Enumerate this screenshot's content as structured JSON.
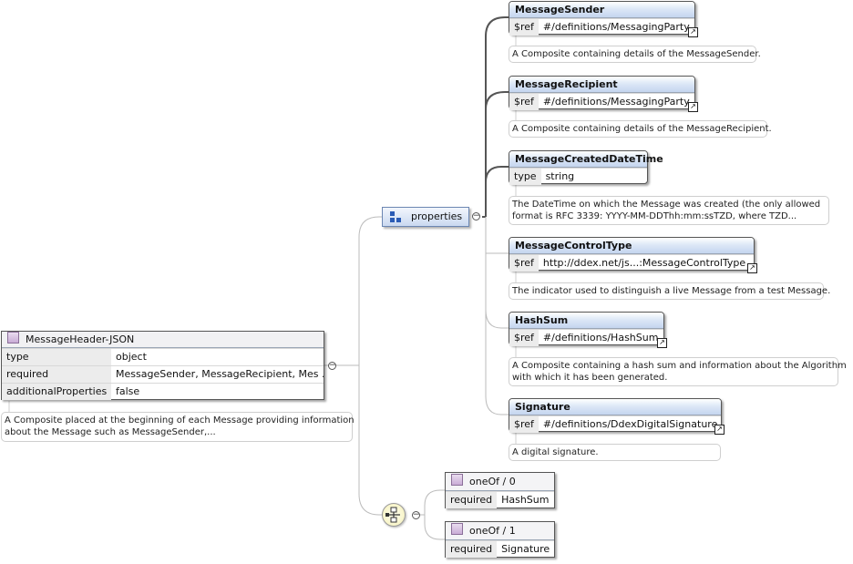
{
  "root": {
    "title": "MessageHeader-JSON",
    "rows": [
      {
        "key": "type",
        "value": "object"
      },
      {
        "key": "required",
        "value": "MessageSender, MessageRecipient, Mes ..."
      },
      {
        "key": "additionalProperties",
        "value": "false"
      }
    ],
    "note_line1": "A Composite placed at the beginning of each Message providing information",
    "note_line2": "about the Message such as MessageSender,..."
  },
  "properties": {
    "label": "properties",
    "icon": "properties-icon"
  },
  "items": [
    {
      "name": "MessageSender",
      "key": "$ref",
      "value": "#/definitions/MessagingParty",
      "note1": "A Composite containing details of the MessageSender.",
      "note2": ""
    },
    {
      "name": "MessageRecipient",
      "key": "$ref",
      "value": "#/definitions/MessagingParty",
      "note1": "A Composite containing details of the MessageRecipient.",
      "note2": ""
    },
    {
      "name": "MessageCreatedDateTime",
      "key": "type",
      "value": "string",
      "note1": "The DateTime on which the Message was created (the only allowed",
      "note2": "format is RFC 3339: YYYY-MM-DDThh:mm:ssTZD, where TZD..."
    },
    {
      "name": "MessageControlType",
      "key": "$ref",
      "value": "http://ddex.net/js...:MessageControlType",
      "note1": "The indicator used to distinguish a live Message from a test Message.",
      "note2": ""
    },
    {
      "name": "HashSum",
      "key": "$ref",
      "value": "#/definitions/HashSum",
      "note1": "A Composite containing a hash sum and information about the Algorithm",
      "note2": "with which it has been generated."
    },
    {
      "name": "Signature",
      "key": "$ref",
      "value": "#/definitions/DdexDigitalSignature",
      "note1": "A digital signature.",
      "note2": ""
    }
  ],
  "oneof": [
    {
      "title": "oneOf / 0",
      "key": "required",
      "value": "HashSum"
    },
    {
      "title": "oneOf / 1",
      "key": "required",
      "value": "Signature"
    }
  ],
  "collapse_symbol": "−",
  "ext_symbol": "↗"
}
